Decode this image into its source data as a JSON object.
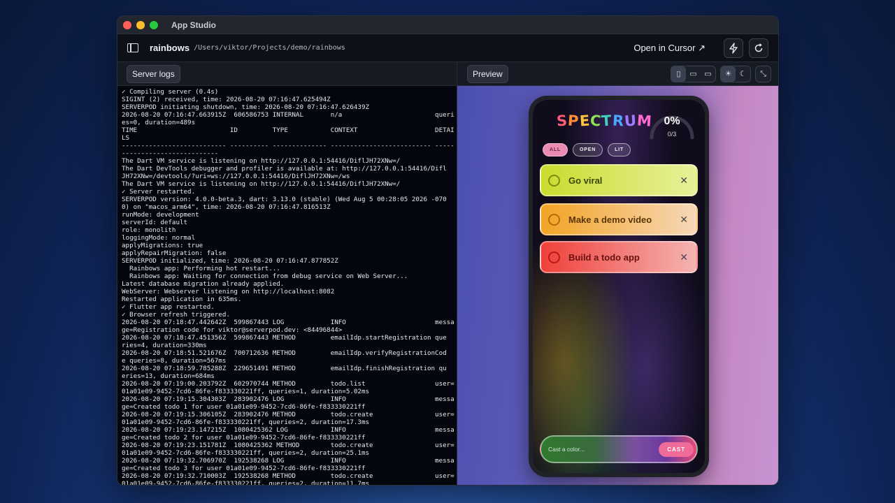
{
  "window": {
    "title": "App Studio"
  },
  "toolbar": {
    "project_name": "rainbows",
    "project_path": "/Users/viktor/Projects/demo/rainbows",
    "open_in_cursor": "Open in Cursor ↗"
  },
  "tabs": {
    "server_logs": "Server logs",
    "preview": "Preview"
  },
  "logs": [
    "✓ Compiling server (0.4s)",
    "SIGINT (2) received, time: 2026-08-20 07:16:47.625494Z",
    "SERVERPOD initiating shutdown, time: 2026-08-20 07:16:47.626439Z",
    "2026-08-20 07:16:47.663915Z  606586753 INTERNAL       n/a                        queri",
    "es=0, duration=489s",
    "TIME                        ID         TYPE           CONTEXT                    DETAI",
    "LS",
    "--------------------------- ---------- -------------- -------------------------- -----",
    "-------------------------",
    "The Dart VM service is listening on http://127.0.0.1:54416/DiflJH72XNw=/",
    "The Dart DevTools debugger and profiler is available at: http://127.0.0.1:54416/Difl",
    "JH72XNw=/devtools/?uri=ws://127.0.0.1:54416/DiflJH72XNw=/ws",
    "The Dart VM service is listening on http://127.0.0.1:54416/DiflJH72XNw=/",
    "✓ Server restarted.",
    "SERVERPOD version: 4.0.0-beta.3, dart: 3.13.0 (stable) (Wed Aug 5 00:28:05 2026 -070",
    "0) on \"macos_arm64\", time: 2026-08-20 07:16:47.816513Z",
    "runMode: development",
    "serverId: default",
    "role: monolith",
    "loggingMode: normal",
    "applyMigrations: true",
    "applyRepairMigration: false",
    "SERVERPOD initialized, time: 2026-08-20 07:16:47.877852Z",
    "  Rainbows app: Performing hot restart...",
    "  Rainbows app: Waiting for connection from debug service on Web Server...",
    "Latest database migration already applied.",
    "WebServer: Webserver listening on http://localhost:8082",
    "Restarted application in 635ms.",
    "✓ Flutter app restarted.",
    "✓ Browser refresh triggered.",
    "2026-08-20 07:18:47.442642Z  599867443 LOG            INFO                       messa",
    "ge=Registration code for viktor@serverpod.dev: <84496844>",
    "2026-08-20 07:18:47.451356Z  599867443 METHOD         emailIdp.startRegistration que",
    "ries=4, duration=330ms",
    "2026-08-20 07:18:51.521676Z  700712636 METHOD         emailIdp.verifyRegistrationCod",
    "e queries=8, duration=567ms",
    "2026-08-20 07:18:59.785288Z  229651491 METHOD         emailIdp.finishRegistration qu",
    "eries=13, duration=684ms",
    "2026-08-20 07:19:00.203792Z  602970744 METHOD         todo.list                  user=",
    "01a01e09-9452-7cd6-86fe-f833330221ff, queries=1, duration=5.02ms",
    "2026-08-20 07:19:15.304303Z  283902476 LOG            INFO                       messa",
    "ge=Created todo 1 for user 01a01e09-9452-7cd6-86fe-f833330221ff",
    "2026-08-20 07:19:15.306105Z  283902476 METHOD         todo.create                user=",
    "01a01e09-9452-7cd6-86fe-f833330221ff, queries=2, duration=17.3ms",
    "2026-08-20 07:19:23.147215Z  1080425362 LOG           INFO                       messa",
    "ge=Created todo 2 for user 01a01e09-9452-7cd6-86fe-f833330221ff",
    "2026-08-20 07:19:23.151781Z  1080425362 METHOD        todo.create                user=",
    "01a01e09-9452-7cd6-86fe-f833330221ff, queries=2, duration=25.1ms",
    "2026-08-20 07:19:32.706970Z  192538268 LOG            INFO                       messa",
    "ge=Created todo 3 for user 01a01e09-9452-7cd6-86fe-f833330221ff",
    "2026-08-20 07:19:32.710003Z  192538268 METHOD         todo.create                user=",
    "01a01e09-9452-7cd6-86fe-f833330221ff, queries=2, duration=11.7ms"
  ],
  "app": {
    "logo": "SPECTRUM",
    "logo_colors": [
      "#ff5a7a",
      "#ff8a3a",
      "#ffc53a",
      "#8fe05a",
      "#3fd0c0",
      "#4aa6ff",
      "#a07aff",
      "#ff6ad0"
    ],
    "progress_percent": "0%",
    "progress_count": "0/3",
    "filters": [
      "ALL",
      "OPEN",
      "LIT"
    ],
    "todos": [
      {
        "label": "Go viral"
      },
      {
        "label": "Make a demo video"
      },
      {
        "label": "Build a todo app"
      }
    ],
    "cast_placeholder": "Cast a color...",
    "cast_button": "CAST"
  },
  "icons": {
    "sidebar": "sidebar-icon",
    "lightning": "lightning-icon",
    "refresh": "refresh-icon",
    "phone": "phone-icon",
    "tablet": "tablet-icon",
    "desktop": "desktop-icon",
    "sun": "sun-icon",
    "moon": "moon-icon",
    "collapse": "collapse-icon"
  }
}
